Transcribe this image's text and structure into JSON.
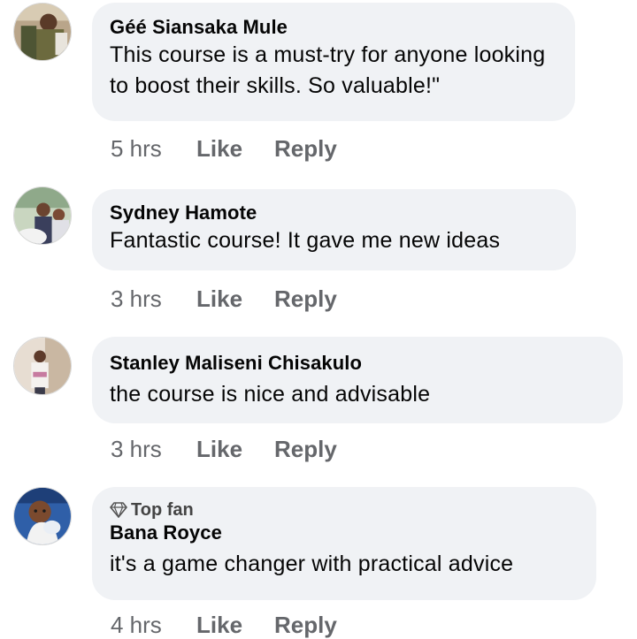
{
  "comments": [
    {
      "author": "Géé Siansaka Mule",
      "badge": "",
      "text": "This course is a must-try for anyone looking to boost their skills. So valuable!\"",
      "time": "5 hrs",
      "like_label": "Like",
      "reply_label": "Reply"
    },
    {
      "author": "Sydney Hamote",
      "badge": "",
      "text": "Fantastic course! It gave me new ideas",
      "time": "3 hrs",
      "like_label": "Like",
      "reply_label": "Reply"
    },
    {
      "author": "Stanley Maliseni Chisakulo",
      "badge": "",
      "text": "the course is nice and advisable",
      "time": "3 hrs",
      "like_label": "Like",
      "reply_label": "Reply"
    },
    {
      "author": "Bana Royce",
      "badge": "Top fan",
      "text": "it's a game changer with practical advice",
      "time": "4 hrs",
      "like_label": "Like",
      "reply_label": "Reply"
    }
  ],
  "colors": {
    "bubble": "#f0f2f5",
    "meta_text": "#65676b"
  }
}
